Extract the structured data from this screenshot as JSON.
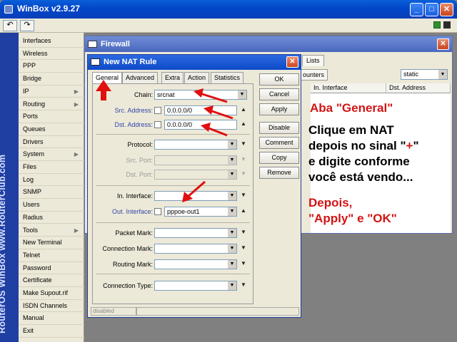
{
  "app": {
    "title": "WinBox v2.9.27",
    "brand": "RouterOS WinBox   www.RouterClub.com"
  },
  "toolbar": {
    "undo": "↶",
    "redo": "↷"
  },
  "sidebar": {
    "items": [
      {
        "label": "Interfaces",
        "submenu": false
      },
      {
        "label": "Wireless",
        "submenu": false
      },
      {
        "label": "PPP",
        "submenu": false
      },
      {
        "label": "Bridge",
        "submenu": false
      },
      {
        "label": "IP",
        "submenu": true
      },
      {
        "label": "Routing",
        "submenu": true
      },
      {
        "label": "Ports",
        "submenu": false
      },
      {
        "label": "Queues",
        "submenu": false
      },
      {
        "label": "Drivers",
        "submenu": false
      },
      {
        "label": "System",
        "submenu": true
      },
      {
        "label": "Files",
        "submenu": false
      },
      {
        "label": "Log",
        "submenu": false
      },
      {
        "label": "SNMP",
        "submenu": false
      },
      {
        "label": "Users",
        "submenu": false
      },
      {
        "label": "Radius",
        "submenu": false
      },
      {
        "label": "Tools",
        "submenu": true
      },
      {
        "label": "New Terminal",
        "submenu": false
      },
      {
        "label": "Telnet",
        "submenu": false
      },
      {
        "label": "Password",
        "submenu": false
      },
      {
        "label": "Certificate",
        "submenu": false
      },
      {
        "label": "Make Supout.rif",
        "submenu": false
      },
      {
        "label": "ISDN Channels",
        "submenu": false
      },
      {
        "label": "Manual",
        "submenu": false
      },
      {
        "label": "Exit",
        "submenu": false
      }
    ]
  },
  "firewall": {
    "title": "Firewall",
    "tab_lists": "Lists",
    "btn_counters": "ounters",
    "filter_value": "static",
    "columns": [
      "In. Interface",
      "Dst. Address"
    ]
  },
  "nat": {
    "title": "New NAT Rule",
    "tabs": [
      "General",
      "Advanced",
      "Extra",
      "Action",
      "Statistics"
    ],
    "fields": {
      "chain": {
        "label": "Chain:",
        "value": "srcnat"
      },
      "src_address": {
        "label": "Src. Address:",
        "value": "0.0.0.0/0"
      },
      "dst_address": {
        "label": "Dst. Address:",
        "value": "0.0.0.0/0"
      },
      "protocol": {
        "label": "Protocol:",
        "value": ""
      },
      "src_port": {
        "label": "Src. Port:",
        "value": ""
      },
      "dst_port": {
        "label": "Dst. Port:",
        "value": ""
      },
      "in_interface": {
        "label": "In. Interface:",
        "value": ""
      },
      "out_interface": {
        "label": "Out. Interface:",
        "value": "pppoe-out1"
      },
      "packet_mark": {
        "label": "Packet Mark:",
        "value": ""
      },
      "connection_mark": {
        "label": "Connection Mark:",
        "value": ""
      },
      "routing_mark": {
        "label": "Routing Mark:",
        "value": ""
      },
      "connection_type": {
        "label": "Connection Type:",
        "value": ""
      }
    },
    "buttons": {
      "ok": "OK",
      "cancel": "Cancel",
      "apply": "Apply",
      "disable": "Disable",
      "comment": "Comment",
      "copy": "Copy",
      "remove": "Remove"
    },
    "status": "disabled"
  },
  "annotations": {
    "heading": "Aba \"General\"",
    "instruction_lines": [
      "Clique em NAT",
      "depois no sinal \"",
      "+",
      "\"",
      "e digite conforme",
      "você está vendo..."
    ],
    "after_lines": [
      "Depois,",
      "\"Apply\" e \"OK\""
    ],
    "arrow_color": "#e01010"
  }
}
